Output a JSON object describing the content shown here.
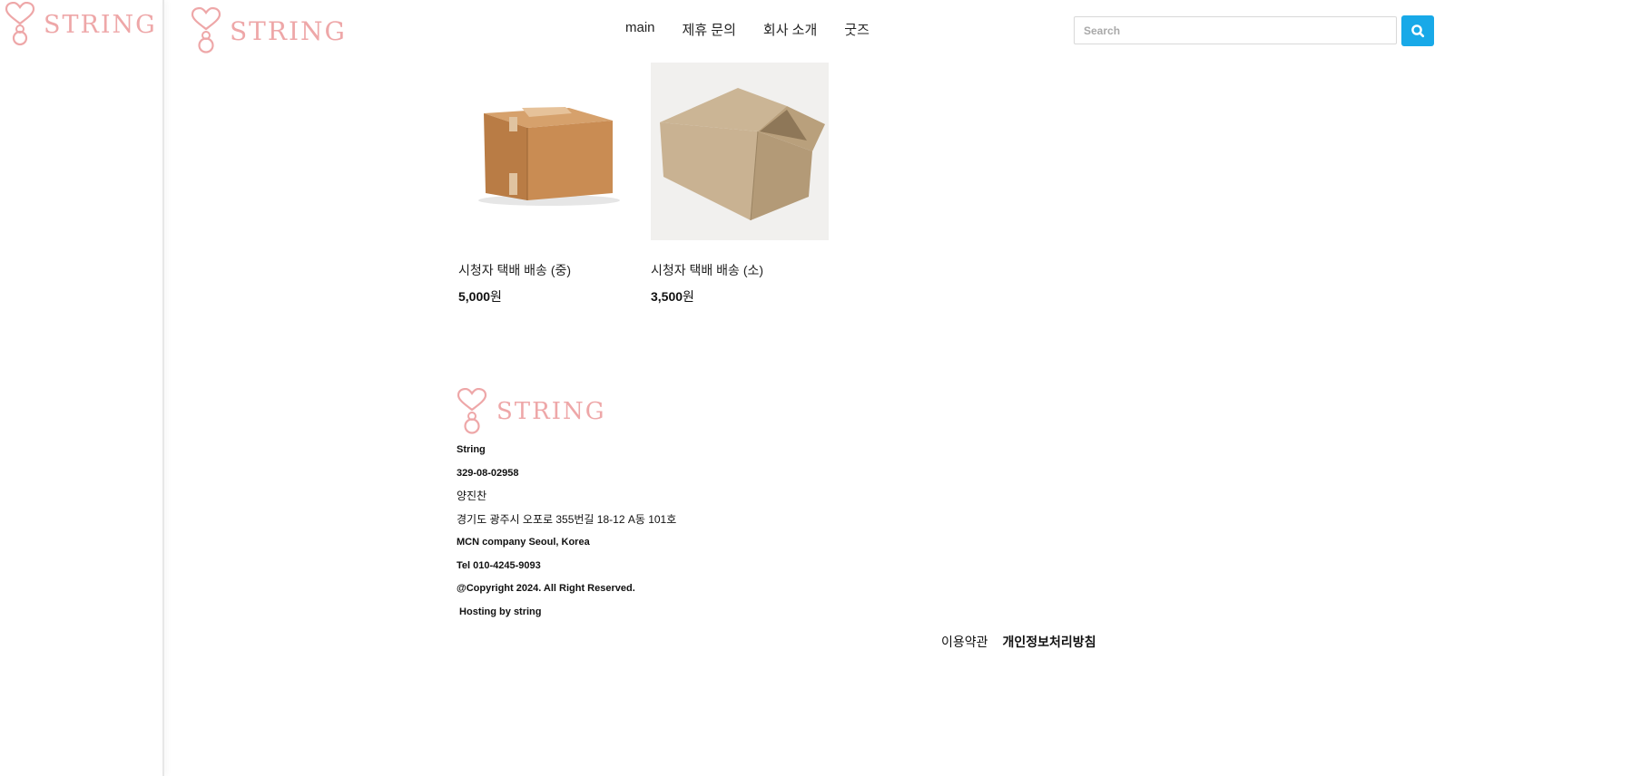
{
  "brand": {
    "name": "STRING",
    "color": "#eea7a8"
  },
  "nav": {
    "items": [
      {
        "label": "main"
      },
      {
        "label": "제휴 문의"
      },
      {
        "label": "회사 소개"
      },
      {
        "label": "굿즈"
      }
    ]
  },
  "search": {
    "placeholder": "Search",
    "button_icon": "search-icon",
    "button_color": "#18a9e8"
  },
  "products": [
    {
      "name": "시청자 택배 배송 (중)",
      "price_number": "5,000",
      "price_unit": "원",
      "image": "closed-cardboard-box"
    },
    {
      "name": "시청자 택배 배송 (소)",
      "price_number": "3,500",
      "price_unit": "원",
      "image": "open-cardboard-box"
    }
  ],
  "footer": {
    "company": "String",
    "business_number": "329-08-02958",
    "representative": "양진찬",
    "address": "경기도 광주시 오포로 355번길 18-12 A동 101호",
    "company_en": "MCN company Seoul, Korea",
    "tel": "Tel 010-4245-9093",
    "copyright": "@Copyright 2024. All Right Reserved.",
    "hosting": " Hosting by string",
    "links": [
      {
        "label": "이용약관"
      },
      {
        "label": "개인정보처리방침"
      }
    ]
  }
}
